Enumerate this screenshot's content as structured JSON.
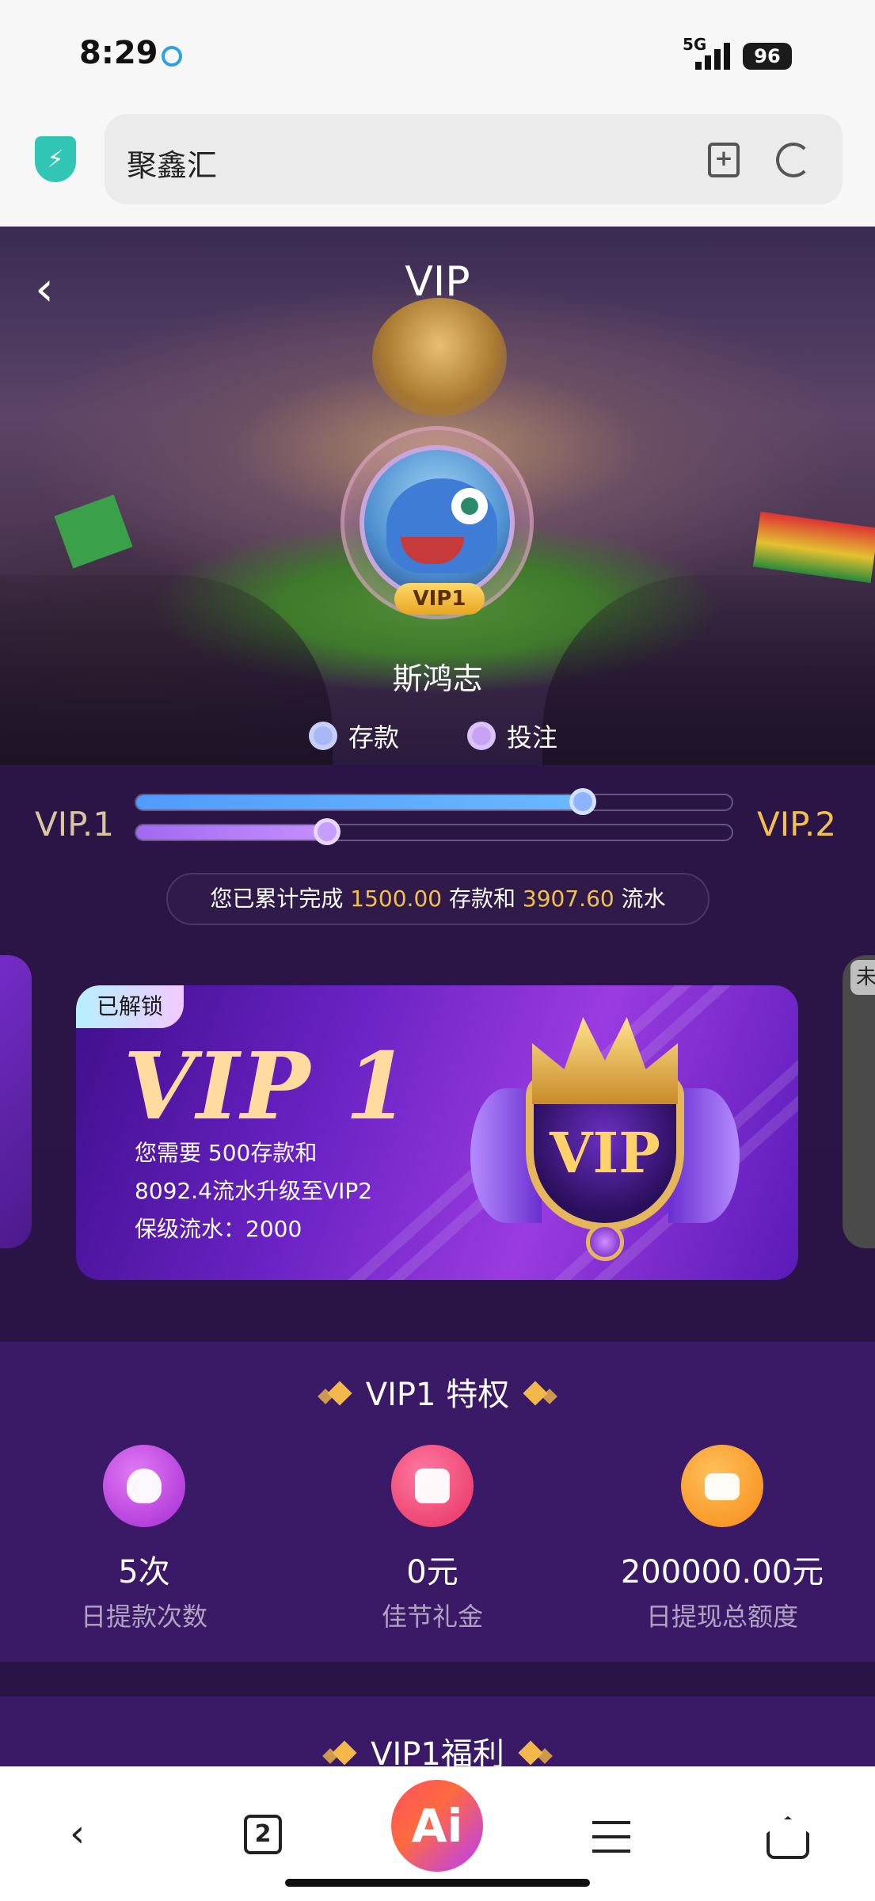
{
  "status_bar": {
    "time": "8:29",
    "network": "5G",
    "battery": "96"
  },
  "browser": {
    "url_text": "聚鑫汇"
  },
  "page": {
    "title": "VIP",
    "username": "斯鸿志",
    "avatar_badge": "VIP1"
  },
  "progress": {
    "legend": [
      {
        "label": "存款",
        "color": "#a9b8f5"
      },
      {
        "label": "投注",
        "color": "#c8a3f5"
      }
    ],
    "current_level": "VIP.1",
    "next_level": "VIP.2",
    "deposit_progress_pct": 75,
    "bet_progress_pct": 32,
    "summary_prefix": "您已累计完成",
    "deposit_amount": "1500.00",
    "summary_mid": "存款和",
    "turnover_amount": "3907.60",
    "summary_suffix": "流水"
  },
  "vip_card": {
    "status_tag": "已解锁",
    "level_name": "VIP 1",
    "line1": "您需要  500存款和",
    "line2": "8092.4流水升级至VIP2",
    "line3": "保级流水：2000",
    "emblem_text": "VIP",
    "next_card_tag": "未"
  },
  "privileges": {
    "title": "VIP1 特权",
    "items": [
      {
        "value": "5次",
        "label": "日提款次数",
        "icon": "money-bag-icon",
        "color": "#b43cdf"
      },
      {
        "value": "0元",
        "label": "佳节礼金",
        "icon": "gift-icon",
        "color": "#f0457a"
      },
      {
        "value": "200000.00元",
        "label": "日提现总额度",
        "icon": "wallet-icon",
        "color": "#f8a22a"
      }
    ]
  },
  "benefits": {
    "title": "VIP1福利"
  },
  "bottom_nav": {
    "tab_count": "2",
    "ai_label": "Ai"
  },
  "colors": {
    "accent_gold": "#f3c04e",
    "deposit_bar": "#5fa8ff",
    "bet_bar": "#b47cf5"
  }
}
